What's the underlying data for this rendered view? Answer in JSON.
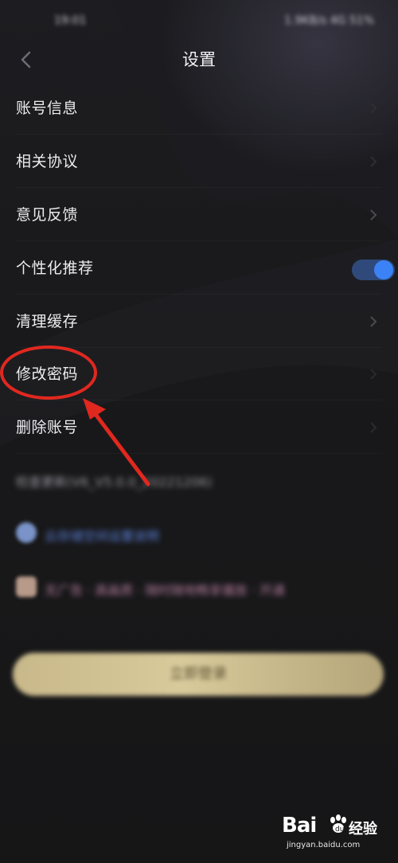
{
  "status_bar": {
    "time": "19:01",
    "right": "1.9KB/s 4G 51%"
  },
  "header": {
    "title": "设置",
    "back_icon": "chevron-left-icon"
  },
  "menu": {
    "items": [
      {
        "label": "账号信息",
        "control": "chevron"
      },
      {
        "label": "相关协议",
        "control": "chevron"
      },
      {
        "label": "意见反馈",
        "control": "chevron"
      },
      {
        "label": "个性化推荐",
        "control": "toggle",
        "toggle_on": true
      },
      {
        "label": "清理缓存",
        "control": "chevron"
      },
      {
        "label": "修改密码",
        "control": "chevron"
      },
      {
        "label": "删除账号",
        "control": "chevron"
      }
    ]
  },
  "blurred": {
    "version_text": "检查更新(V6_V5.0.0_20221206)",
    "link_text": "云存储空间设置说明",
    "ad_text": "无广告 · 高画质 · 随时随地畅享播放 · 开通"
  },
  "login_button": {
    "label": "立即登录"
  },
  "annotation": {
    "circle_color": "#e0281f",
    "arrow_color": "#e0281f"
  },
  "watermark": {
    "brand": "Bai",
    "suffix": "经验",
    "domain": "jingyan.baidu.com"
  },
  "colors": {
    "toggle_on": "#3b82f6",
    "login_gold": "#d8ca9b"
  }
}
